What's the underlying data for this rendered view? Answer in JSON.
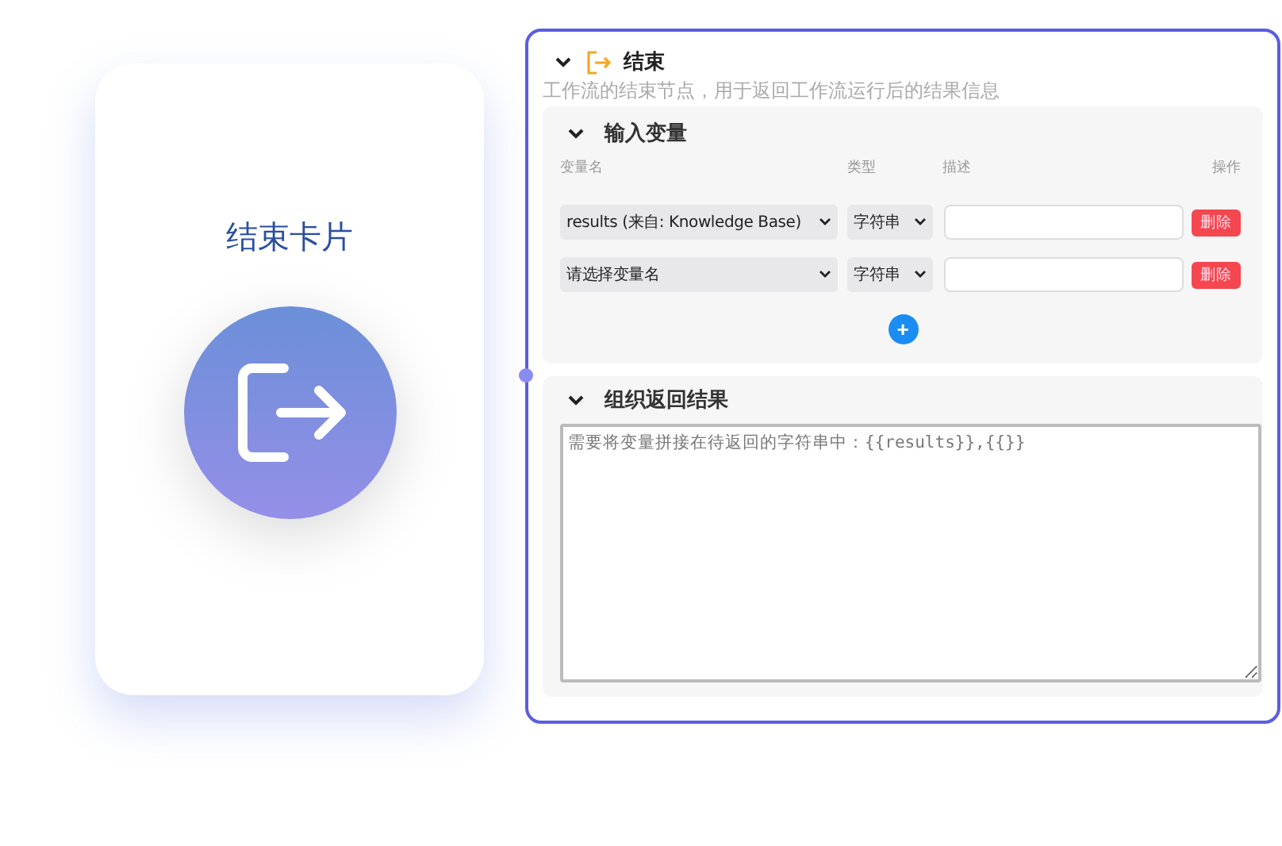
{
  "card": {
    "title": "结束卡片"
  },
  "node": {
    "title": "结束",
    "expanded": true,
    "description": "工作流的结束节点，用于返回工作流运行后的结果信息",
    "inputs": {
      "title": "输入变量",
      "expanded": true,
      "columns": [
        "变量名",
        "类型",
        "描述",
        "操作"
      ],
      "rows": [
        {
          "variable": "results (来自: Knowledge Base)",
          "type": "字符串",
          "delete": "删除"
        },
        {
          "variable": "请选择变量名",
          "type": "字符串",
          "delete": "删除"
        }
      ],
      "add": "+"
    },
    "output": {
      "title": "组织返回结果",
      "expanded": true,
      "placeholder": "需要将变量拼接在待返回的字符串中：{{results}},{{}}"
    }
  }
}
